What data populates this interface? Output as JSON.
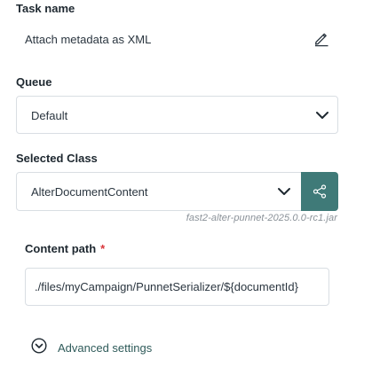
{
  "task": {
    "label": "Task name",
    "value": "Attach metadata as XML",
    "edit_icon": "pencil-icon"
  },
  "queue": {
    "label": "Queue",
    "selected": "Default",
    "chevron_icon": "chevron-down-icon"
  },
  "selected_class": {
    "label": "Selected Class",
    "selected": "AlterDocumentContent",
    "chevron_icon": "chevron-down-icon",
    "share_icon": "share-icon",
    "share_button_color": "#3f7a78",
    "jar": "fast2-alter-punnet-2025.0.0-rc1.jar"
  },
  "content_path": {
    "label": "Content path",
    "required_mark": "*",
    "value": "./files/myCampaign/PunnetSerializer/${documentId}"
  },
  "advanced": {
    "label": "Advanced settings",
    "icon": "chevron-circle-down-icon"
  }
}
